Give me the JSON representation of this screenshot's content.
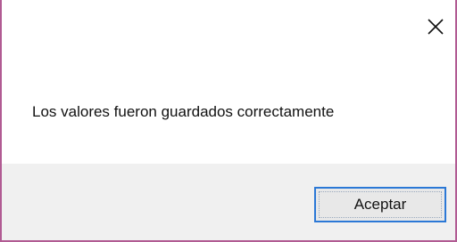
{
  "dialog": {
    "close_icon": "close-icon",
    "message": "Los valores fueron guardados correctamente",
    "ok_label": "Aceptar",
    "colors": {
      "border": "#b15b93",
      "footer": "#f0f0f0",
      "button_border": "#2b78d6",
      "button_fill": "#e8e8e8"
    }
  }
}
